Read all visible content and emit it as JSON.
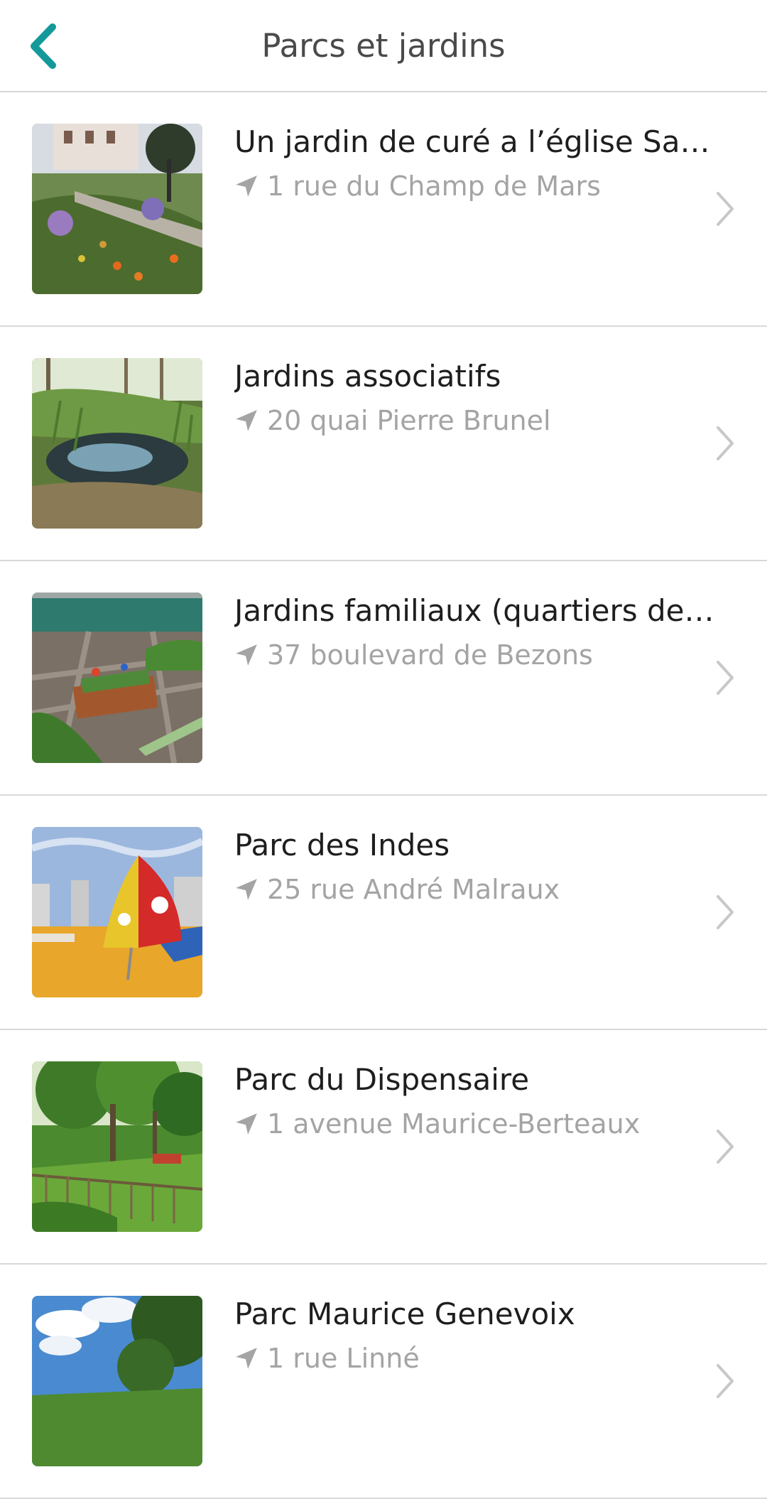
{
  "header": {
    "title": "Parcs et jardins",
    "back_icon": "chevron-left-icon"
  },
  "colors": {
    "accent": "#14999a",
    "title_text": "#1e1e1e",
    "address_text": "#a4a4a4",
    "chevron": "#c8c8c8",
    "divider": "#d9d9d9"
  },
  "items": [
    {
      "title": "Un jardin de curé a l’église Saint-…",
      "address": "1 rue du Champ de Mars",
      "image": "garden-house-photo"
    },
    {
      "title": "Jardins associatifs",
      "address": "20 quai Pierre Brunel",
      "image": "pond-photo"
    },
    {
      "title": "Jardins familiaux (quartiers des…",
      "address": "37 boulevard de Bezons",
      "image": "vegetable-plot-photo"
    },
    {
      "title": "Parc des Indes",
      "address": "25 rue André Malraux",
      "image": "playground-photo"
    },
    {
      "title": "Parc du Dispensaire",
      "address": "1 avenue Maurice-Berteaux",
      "image": "park-trees-photo"
    },
    {
      "title": "Parc Maurice Genevoix",
      "address": "1 rue Linné",
      "image": "sky-trees-photo"
    }
  ]
}
